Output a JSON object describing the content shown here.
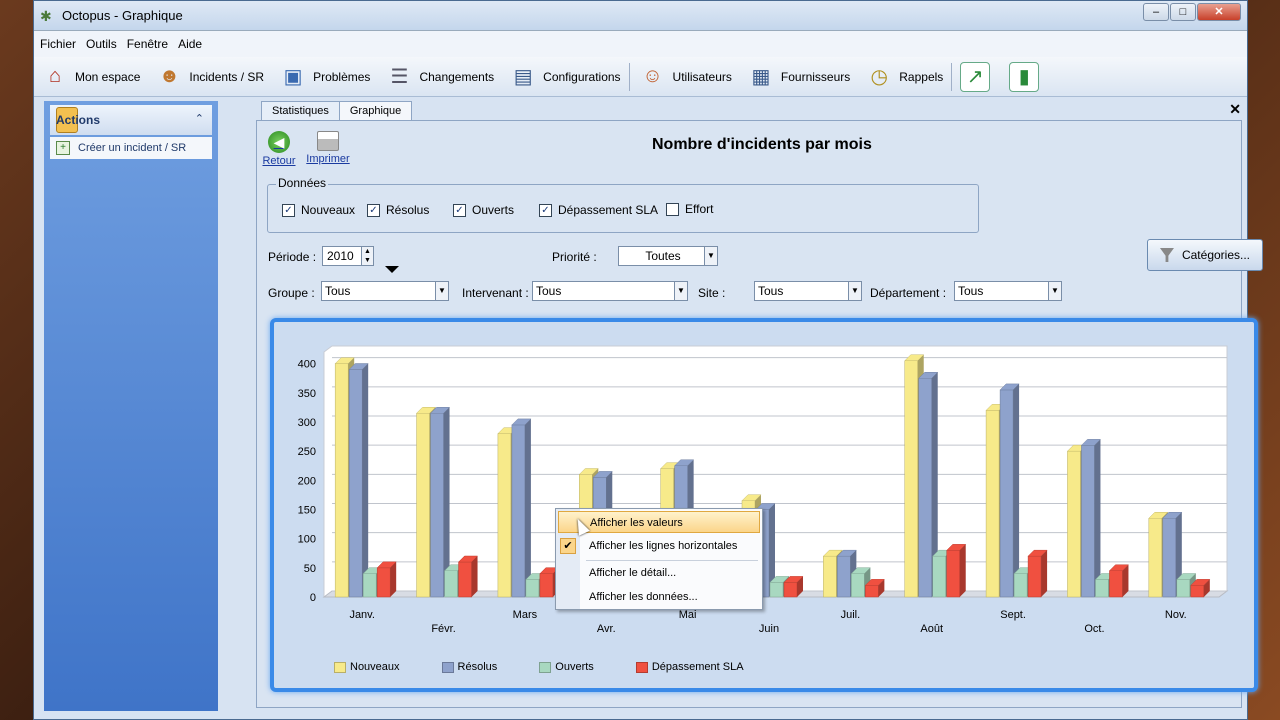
{
  "window": {
    "title": "Octopus - Graphique"
  },
  "menu": [
    "Fichier",
    "Outils",
    "Fenêtre",
    "Aide"
  ],
  "toolbar": [
    {
      "label": "Mon espace",
      "icon": "house-icon"
    },
    {
      "label": "Incidents / SR",
      "icon": "user-computer-icon"
    },
    {
      "label": "Problèmes",
      "icon": "toolbox-icon"
    },
    {
      "label": "Changements",
      "icon": "document-list-icon"
    },
    {
      "label": "Configurations",
      "icon": "network-computer-icon"
    },
    {
      "label": "Utilisateurs",
      "icon": "users-icon"
    },
    {
      "label": "Fournisseurs",
      "icon": "building-icon"
    },
    {
      "label": "Rappels",
      "icon": "clock-note-icon"
    }
  ],
  "sidebar": {
    "section": "Actions",
    "items": [
      "Créer un incident / SR"
    ]
  },
  "tabs": [
    "Statistiques",
    "Graphique"
  ],
  "actions": {
    "back": "Retour",
    "print": "Imprimer"
  },
  "page_title": "Nombre d'incidents par mois",
  "data_group": {
    "legend": "Données",
    "checks": [
      {
        "label": "Nouveaux",
        "checked": true
      },
      {
        "label": "Résolus",
        "checked": true
      },
      {
        "label": "Ouverts",
        "checked": true
      },
      {
        "label": "Dépassement SLA",
        "checked": true
      },
      {
        "label": "Effort",
        "checked": false
      }
    ]
  },
  "filters": {
    "periode_label": "Période :",
    "periode_value": "2010",
    "priorite_label": "Priorité :",
    "priorite_value": "Toutes",
    "groupe_label": "Groupe :",
    "groupe_value": "Tous",
    "intervenant_label": "Intervenant :",
    "intervenant_value": "Tous",
    "site_label": "Site :",
    "site_value": "Tous",
    "departement_label": "Département :",
    "departement_value": "Tous",
    "categories_button": "Catégories..."
  },
  "context_menu": [
    {
      "label": "Afficher les valeurs",
      "highlighted": true,
      "checked": false
    },
    {
      "label": "Afficher les lignes horizontales",
      "highlighted": false,
      "checked": true
    },
    {
      "label": "Afficher le détail...",
      "highlighted": false,
      "checked": false
    },
    {
      "label": "Afficher les données...",
      "highlighted": false,
      "checked": false
    }
  ],
  "chart_data": {
    "type": "bar",
    "title": "",
    "categories": [
      "Janv.",
      "Févr.",
      "Mars",
      "Avr.",
      "Mai",
      "Juin",
      "Juil.",
      "Août",
      "Sept.",
      "Oct.",
      "Nov."
    ],
    "series": [
      {
        "name": "Nouveaux",
        "color": "#f7ea8a",
        "values": [
          400,
          315,
          280,
          210,
          220,
          165,
          70,
          405,
          320,
          250,
          135
        ]
      },
      {
        "name": "Résolus",
        "color": "#8ea2cc",
        "values": [
          390,
          315,
          295,
          205,
          225,
          150,
          70,
          375,
          355,
          260,
          135
        ]
      },
      {
        "name": "Ouverts",
        "color": "#a8d8c0",
        "values": [
          40,
          45,
          30,
          20,
          25,
          25,
          40,
          70,
          40,
          30,
          30
        ]
      },
      {
        "name": "Dépassement SLA",
        "color": "#f05040",
        "values": [
          50,
          60,
          40,
          30,
          30,
          25,
          20,
          80,
          70,
          45,
          20
        ]
      }
    ],
    "ylim": [
      0,
      420
    ],
    "yticks": [
      0,
      50,
      100,
      150,
      200,
      250,
      300,
      350,
      400
    ],
    "grid": true,
    "legend_position": "bottom-left"
  }
}
